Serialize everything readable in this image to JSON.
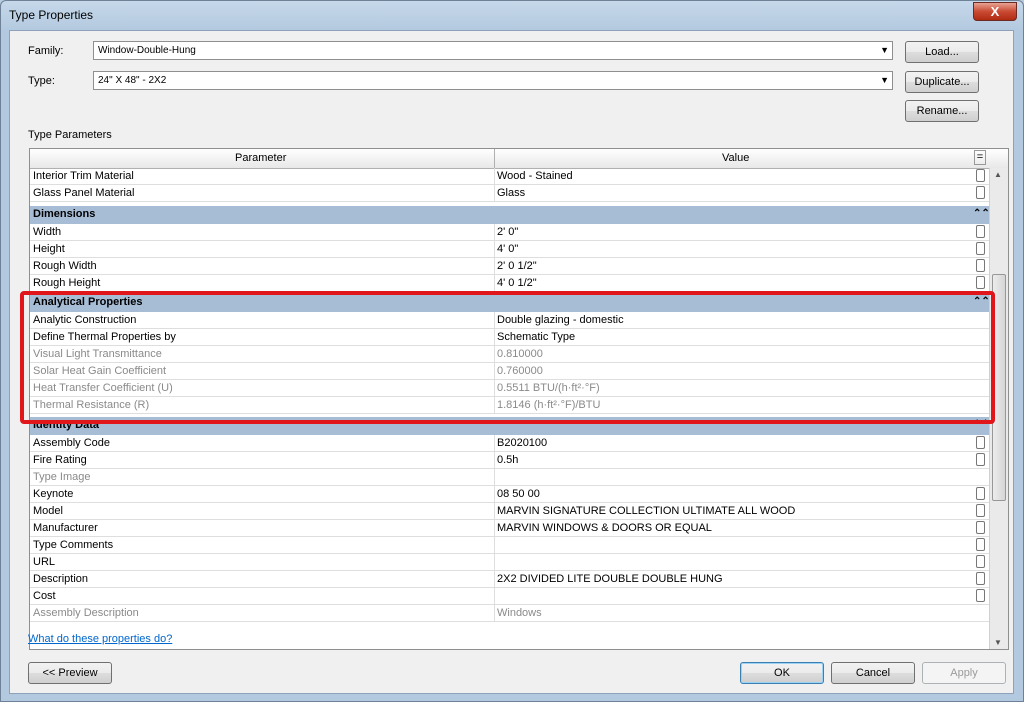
{
  "window": {
    "title": "Type Properties",
    "close": "X"
  },
  "family": {
    "label": "Family:",
    "value": "Window-Double-Hung"
  },
  "type": {
    "label": "Type:",
    "value": "24\" X 48\" - 2X2"
  },
  "buttons": {
    "load": "Load...",
    "duplicate": "Duplicate...",
    "rename": "Rename...",
    "preview": "<< Preview",
    "ok": "OK",
    "cancel": "Cancel",
    "apply": "Apply"
  },
  "section_label": "Type Parameters",
  "grid": {
    "header_parameter": "Parameter",
    "header_value": "Value",
    "header_menu": "=",
    "materials": [
      {
        "p": "Interior Trim Material",
        "v": "Wood - Stained"
      },
      {
        "p": "Glass Panel Material",
        "v": "Glass"
      }
    ],
    "dimensions_title": "Dimensions",
    "dimensions": [
      {
        "p": "Width",
        "v": "2'  0\""
      },
      {
        "p": "Height",
        "v": "4'  0\""
      },
      {
        "p": "Rough Width",
        "v": "2'  0 1/2\""
      },
      {
        "p": "Rough Height",
        "v": "4'  0 1/2\""
      }
    ],
    "analytical_title": "Analytical Properties",
    "analytical": [
      {
        "p": "Analytic Construction",
        "v": "Double glazing - domestic"
      },
      {
        "p": "Define Thermal Properties by",
        "v": "Schematic Type"
      },
      {
        "p": "Visual Light Transmittance",
        "v": "0.810000"
      },
      {
        "p": "Solar Heat Gain Coefficient",
        "v": "0.760000"
      },
      {
        "p": "Heat Transfer Coefficient (U)",
        "v": "0.5511 BTU/(h·ft²·°F)"
      },
      {
        "p": "Thermal Resistance (R)",
        "v": "1.8146 (h·ft²·°F)/BTU"
      }
    ],
    "identity_title": "Identity Data",
    "identity": [
      {
        "p": "Assembly Code",
        "v": "B2020100"
      },
      {
        "p": "Fire Rating",
        "v": "0.5h"
      },
      {
        "p": "Type Image",
        "v": ""
      },
      {
        "p": "Keynote",
        "v": "08 50 00"
      },
      {
        "p": "Model",
        "v": "MARVIN SIGNATURE COLLECTION ULTIMATE ALL WOOD"
      },
      {
        "p": "Manufacturer",
        "v": "MARVIN WINDOWS & DOORS OR EQUAL"
      },
      {
        "p": "Type Comments",
        "v": ""
      },
      {
        "p": "URL",
        "v": ""
      },
      {
        "p": "Description",
        "v": "2X2 DIVIDED LITE DOUBLE DOUBLE HUNG"
      },
      {
        "p": "Cost",
        "v": ""
      },
      {
        "p": "Assembly Description",
        "v": "Windows"
      }
    ]
  },
  "help_link": "What do these properties do?"
}
